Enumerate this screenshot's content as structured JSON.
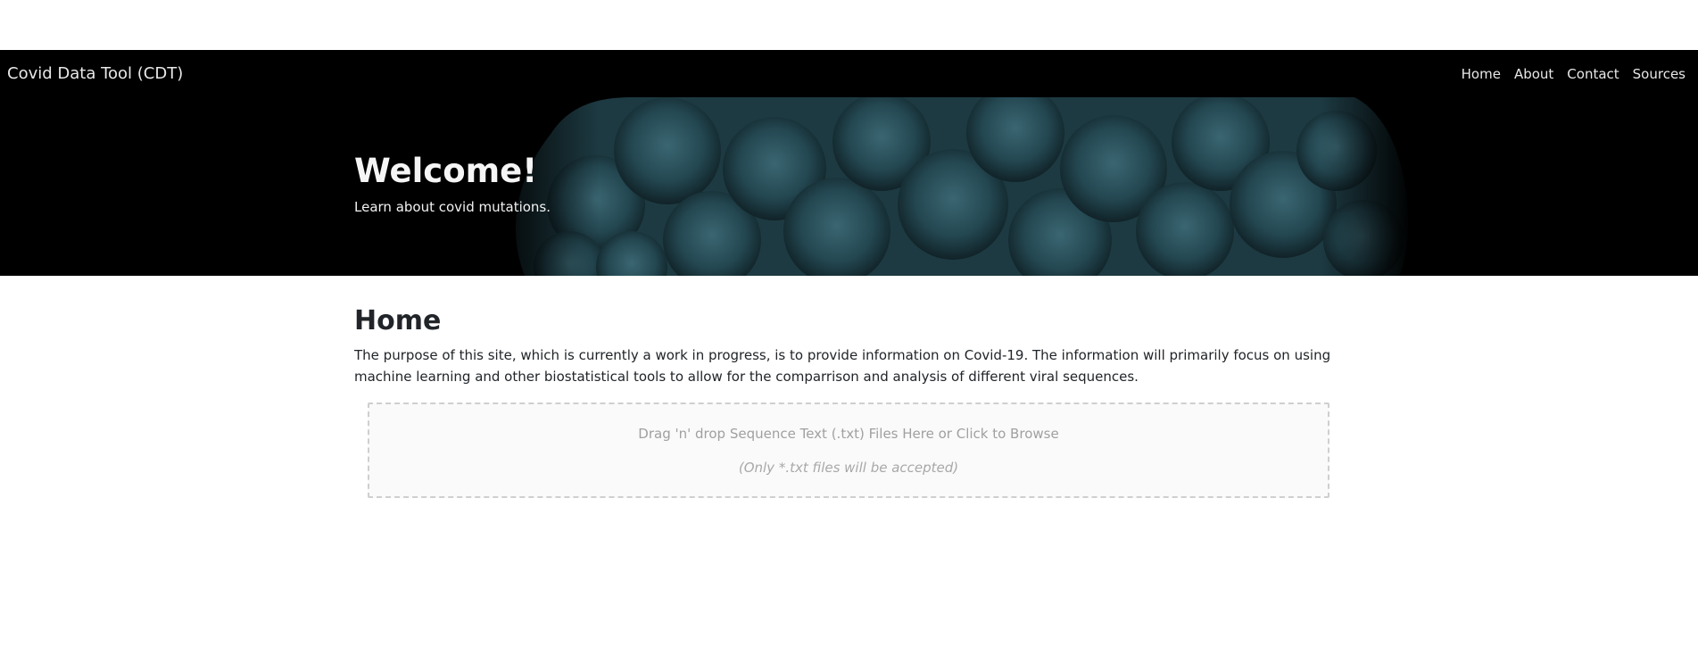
{
  "navbar": {
    "brand": "Covid Data Tool (CDT)",
    "links": [
      "Home",
      "About",
      "Contact",
      "Sources"
    ]
  },
  "hero": {
    "title": "Welcome!",
    "subtitle": "Learn about covid mutations."
  },
  "main": {
    "heading": "Home",
    "description": "The purpose of this site, which is currently a work in progress, is to provide information on Covid-19. The information will primarily focus on using machine learning and other biostatistical tools to allow for the comparrison and analysis of different viral sequences."
  },
  "dropzone": {
    "prompt": "Drag 'n' drop Sequence Text (.txt) Files Here or Click to Browse",
    "note": "(Only *.txt files will be accepted)"
  },
  "colors": {
    "navbar_bg": "#000000",
    "hero_art": "#22444c",
    "text": "#212529",
    "dropzone_border": "#cfcfcf"
  }
}
